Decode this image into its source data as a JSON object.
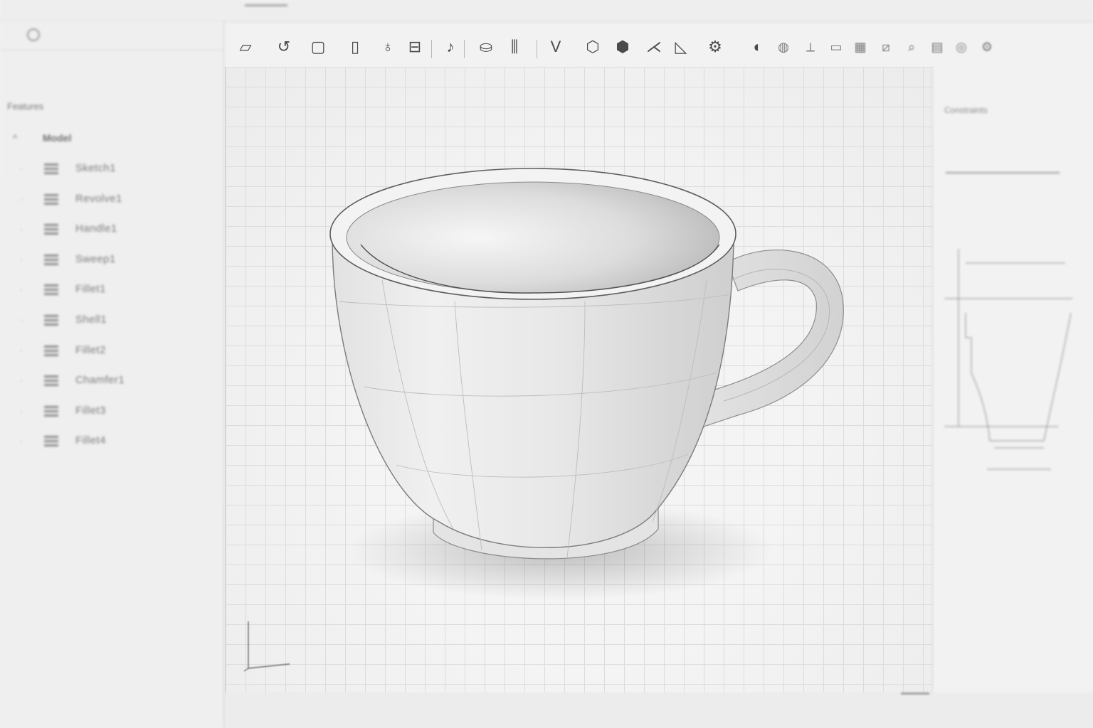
{
  "left_panel": {
    "section_title": "Features",
    "root": {
      "chevron": "^",
      "name": "Model"
    },
    "items": [
      {
        "chevron": "·",
        "label": "Sketch1"
      },
      {
        "chevron": "·",
        "label": "Revolve1"
      },
      {
        "chevron": "·",
        "label": "Handle1"
      },
      {
        "chevron": "·",
        "label": "Sweep1"
      },
      {
        "chevron": "·",
        "label": "Fillet1"
      },
      {
        "chevron": "·",
        "label": "Shell1"
      },
      {
        "chevron": "·",
        "label": "Fillet2"
      },
      {
        "chevron": "·",
        "label": "Chamfer1"
      },
      {
        "chevron": "·",
        "label": "Fillet3"
      },
      {
        "chevron": "·",
        "label": "Fillet4"
      }
    ]
  },
  "toolbar": {
    "items": [
      {
        "icon": "sketch-icon",
        "glyph": "▱"
      },
      {
        "icon": "undo-icon",
        "glyph": "↺"
      },
      {
        "icon": "rectangle-icon",
        "glyph": "▢"
      },
      {
        "icon": "panel-icon",
        "glyph": "▯"
      },
      {
        "icon": "revolve-icon",
        "glyph": "♁"
      },
      {
        "icon": "extrude-icon",
        "glyph": "⊟"
      },
      {
        "icon": "sweep-icon",
        "glyph": "♪"
      },
      {
        "icon": "loft-icon",
        "glyph": "⛀"
      },
      {
        "icon": "pattern-icon",
        "glyph": "⫼"
      },
      {
        "icon": "chamfer-icon",
        "glyph": "V"
      },
      {
        "icon": "hexagon-icon",
        "glyph": "⬡"
      },
      {
        "icon": "polygon-icon",
        "glyph": "⬢"
      },
      {
        "icon": "split-icon",
        "glyph": "⋌"
      },
      {
        "icon": "mirror-icon",
        "glyph": "◺"
      },
      {
        "icon": "assembly-icon",
        "glyph": "⚙"
      },
      {
        "icon": "shell-icon",
        "glyph": "◐"
      },
      {
        "icon": "sphere-icon",
        "glyph": "◍"
      },
      {
        "icon": "measure-icon",
        "glyph": "⟂"
      },
      {
        "icon": "section-icon",
        "glyph": "▭"
      },
      {
        "icon": "calendar-icon",
        "glyph": "▦"
      },
      {
        "icon": "plane-icon",
        "glyph": "⧄"
      },
      {
        "icon": "zoom-icon",
        "glyph": "⌕"
      },
      {
        "icon": "view-icon",
        "glyph": "▤"
      },
      {
        "icon": "render-icon",
        "glyph": "◎"
      },
      {
        "icon": "settings-icon",
        "glyph": "⚙"
      }
    ]
  },
  "right_panel": {
    "title": "Constraints"
  }
}
